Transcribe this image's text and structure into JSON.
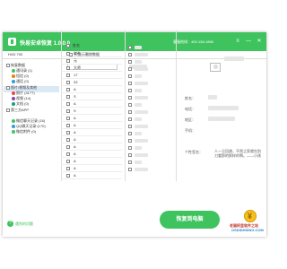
{
  "titlebar": {
    "title": "快易安卓恢复 1.0.0.0",
    "hotline": "客服热线：400-158-1866",
    "btn_menu": "≡",
    "btn_min": "—",
    "btn_close": "✕"
  },
  "toolbar": {
    "device": "HXD 700",
    "only_deleted": "只显示删除数据"
  },
  "tree": {
    "items": [
      {
        "label": "恢复数据",
        "color": "#777"
      },
      {
        "label": "通讯录 (1)",
        "color": "#3fc35e"
      },
      {
        "label": "短信 (0)",
        "color": "#e67e22"
      },
      {
        "label": "通话 (0)",
        "color": "#3498db"
      },
      {
        "label": "照片/视频及其他",
        "color": "#777"
      },
      {
        "label": "照片 (4177)",
        "color": "#e74c3c"
      },
      {
        "label": "视频 (14)",
        "color": "#8e44ad"
      },
      {
        "label": "文档 (0)",
        "color": "#16a085"
      },
      {
        "label": "第三方APP",
        "color": "#777"
      },
      {
        "label": "微信聊天记录 (16)",
        "color": "#3fc35e"
      },
      {
        "label": "QQ聊天记录 (170)",
        "color": "#3498db"
      },
      {
        "label": "微信附件 (0)",
        "color": "#3fc35e"
      }
    ]
  },
  "contacts": {
    "header": "姓名",
    "rows": [
      "联系",
      "元",
      "大师",
      "17",
      "33",
      "A",
      "S",
      "A",
      "S",
      "A",
      "A",
      "A",
      "A",
      "A",
      "A",
      "A",
      "A",
      "A"
    ]
  },
  "detail": {
    "name_label": "姓名：",
    "name_value": "方",
    "phone_label": "电话：",
    "phone_value": "1",
    "area_label": "地区：",
    "area_value": "",
    "mobile_label": "手机：",
    "mobile_value": "",
    "sig_label": "个性签名：",
    "sig_value": "人一旦回避，不然之家就在别刀看那的那样的啊。——小孩"
  },
  "footer": {
    "help": "遇到的问题",
    "recover": "恢复到电脑"
  },
  "watermark": {
    "line1": "老猫阿里软件之站",
    "line2": "OSDIDHSING.COM"
  },
  "colors": {
    "accent": "#3fc35e"
  }
}
